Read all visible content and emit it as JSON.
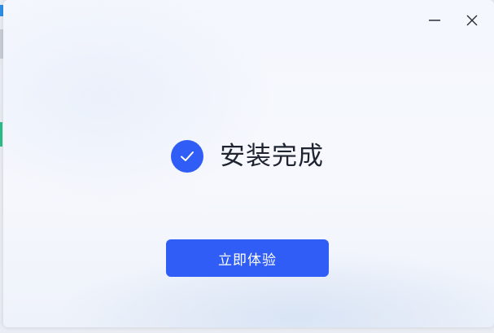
{
  "window": {
    "controls": {
      "minimize_icon": "minimize-icon",
      "close_icon": "close-icon"
    }
  },
  "main": {
    "status_icon": "checkmark-circle-icon",
    "status_title": "安装完成",
    "primary_button_label": "立即体验"
  },
  "colors": {
    "accent": "#2f5df5",
    "title_text": "#1f2430",
    "button_text": "#ffffff"
  }
}
